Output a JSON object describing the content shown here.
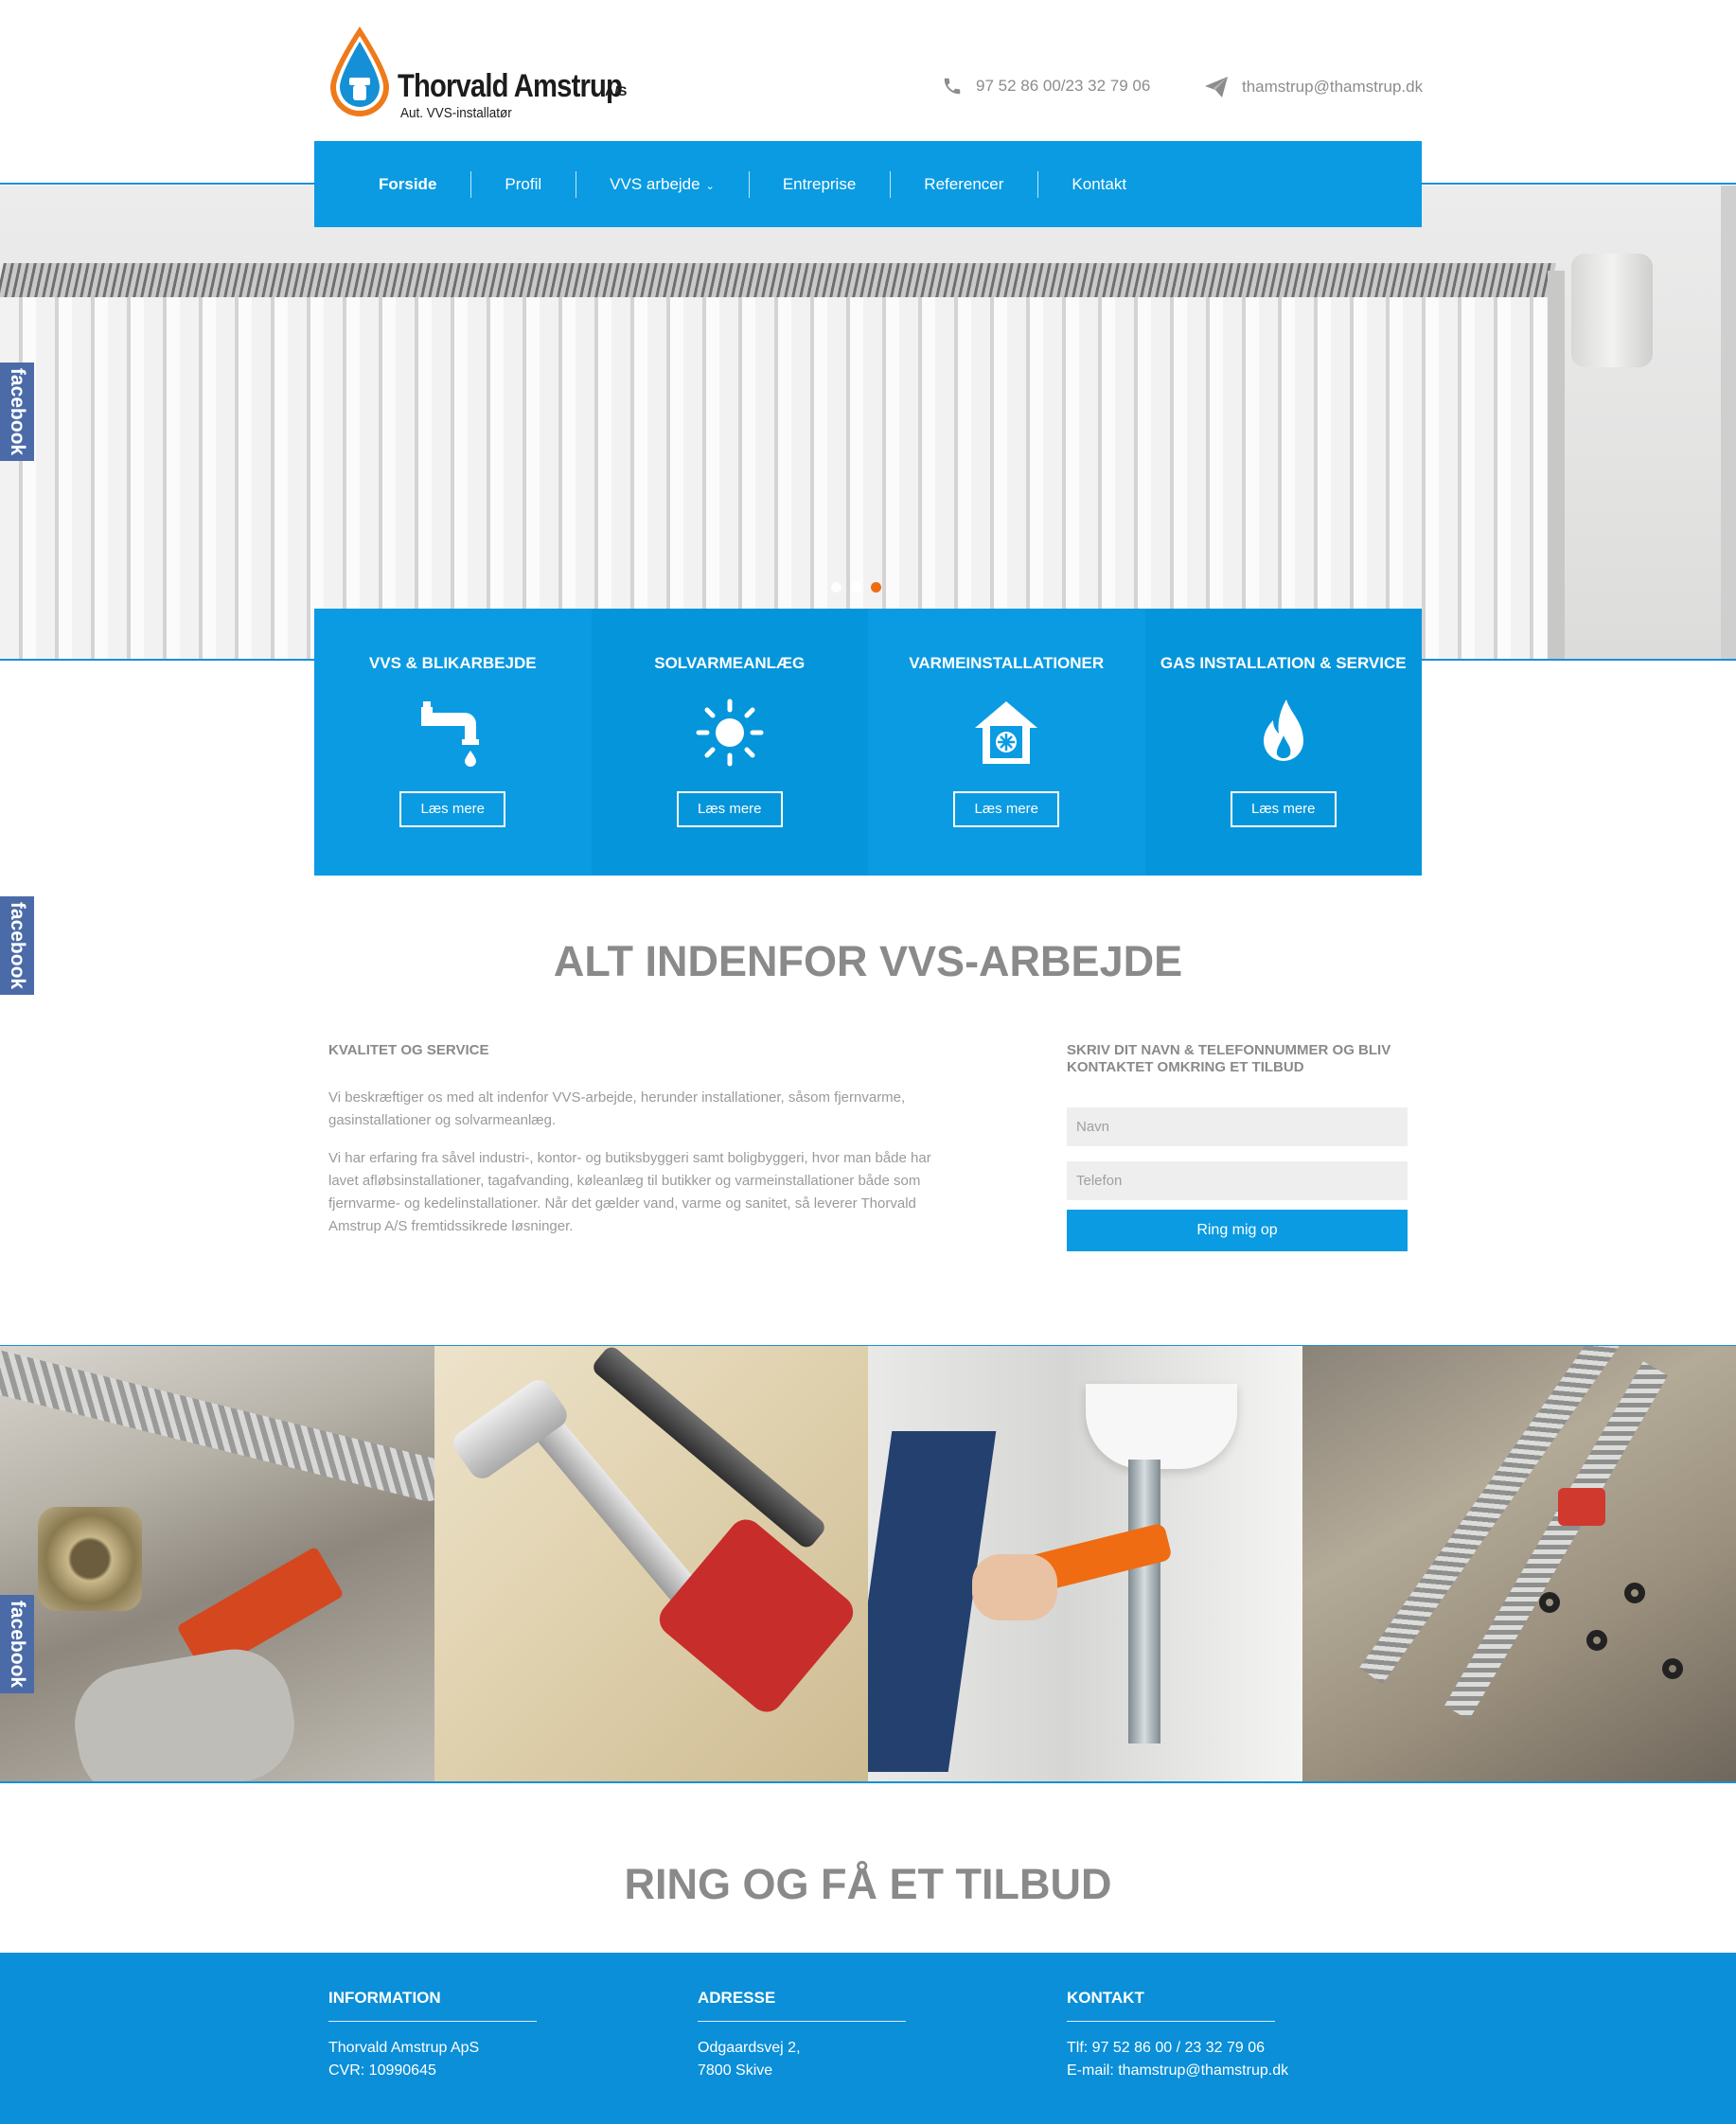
{
  "header": {
    "logo_name": "Thorvald Amstrup",
    "logo_suffix": "A/S",
    "logo_tagline": "Aut. VVS-installatør",
    "phone": "97 52 86 00/23 32 79 06",
    "email": "thamstrup@thamstrup.dk"
  },
  "nav": {
    "items": [
      {
        "label": "Forside",
        "active": true
      },
      {
        "label": "Profil"
      },
      {
        "label": "VVS arbejde",
        "has_dropdown": true
      },
      {
        "label": "Entreprise"
      },
      {
        "label": "Referencer"
      },
      {
        "label": "Kontakt"
      }
    ]
  },
  "slider": {
    "slides": 3,
    "active_slide": 3
  },
  "social": {
    "facebook_label": "facebook"
  },
  "services": [
    {
      "title": "VVS & BLIKARBEJDE",
      "icon": "faucet-icon",
      "button": "Læs mere"
    },
    {
      "title": "SOLVARMEANLÆG",
      "icon": "sun-icon",
      "button": "Læs mere"
    },
    {
      "title": "VARMEINSTALLATIONER",
      "icon": "house-heating-icon",
      "button": "Læs mere"
    },
    {
      "title": "GAS INSTALLATION & SERVICE",
      "icon": "flame-icon",
      "button": "Læs mere"
    }
  ],
  "intro": {
    "heading": "ALT INDENFOR VVS-ARBEJDE",
    "subheading": "KVALITET OG SERVICE",
    "paragraph_1": "Vi beskræftiger os med alt indenfor VVS-arbejde, herunder installationer, såsom fjernvarme, gasinstallationer og solvarmeanlæg.",
    "paragraph_2": "Vi har erfaring fra såvel industri-, kontor- og butiksbyggeri samt boligbyggeri, hvor man både har lavet afløbsinstallationer, tagafvanding, køleanlæg til butikker og varmeinstallationer både som fjernvarme- og kedelinstallationer. Når det gælder vand, varme og sanitet, så leverer Thorvald Amstrup A/S fremtidssikrede løsninger."
  },
  "callback_form": {
    "heading": "SKRIV DIT NAVN & TELEFONNUMMER OG BLIV KONTAKTET OMKRING ET TILBUD",
    "name_placeholder": "Navn",
    "phone_placeholder": "Telefon",
    "submit_label": "Ring mig op"
  },
  "ring_section": {
    "heading": "RING OG FÅ ET TILBUD"
  },
  "footer": {
    "information": {
      "title": "INFORMATION",
      "lines": [
        "Thorvald Amstrup ApS",
        "CVR: 10990645"
      ]
    },
    "address": {
      "title": "ADRESSE",
      "lines": [
        "Odgaardsvej 2,",
        "7800 Skive"
      ]
    },
    "contact": {
      "title": "KONTAKT",
      "lines": [
        "Tlf: 97 52 86 00 / 23 32 79 06",
        "E-mail: thamstrup@thamstrup.dk"
      ]
    }
  },
  "colors": {
    "primary_blue": "#0a9be2",
    "footer_blue": "#0a8fd8",
    "accent_orange": "#ef6c12",
    "facebook_blue": "#4a6ba8"
  }
}
